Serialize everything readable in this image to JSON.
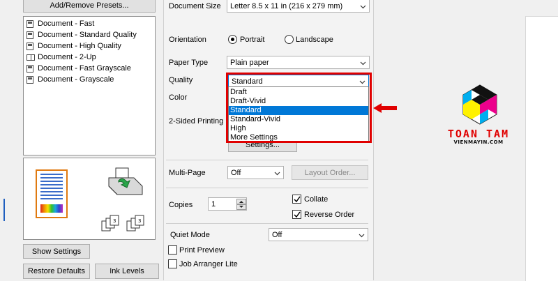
{
  "left_panel": {
    "add_remove_presets": "Add/Remove Presets...",
    "presets": [
      "Document - Fast",
      "Document - Standard Quality",
      "Document - High Quality",
      "Document - 2-Up",
      "Document - Fast Grayscale",
      "Document - Grayscale"
    ],
    "show_settings": "Show Settings",
    "restore_defaults": "Restore Defaults",
    "ink_levels": "Ink Levels"
  },
  "main": {
    "document_size": {
      "label": "Document Size",
      "value": "Letter 8.5 x 11 in (216 x 279 mm)"
    },
    "orientation": {
      "label": "Orientation",
      "portrait": "Portrait",
      "landscape": "Landscape",
      "selected": "Portrait"
    },
    "paper_type": {
      "label": "Paper Type",
      "value": "Plain paper"
    },
    "quality": {
      "label": "Quality",
      "value": "Standard",
      "options": [
        "Draft",
        "Draft-Vivid",
        "Standard",
        "Standard-Vivid",
        "High",
        "More Settings"
      ],
      "selected_index": 2
    },
    "color": {
      "label": "Color"
    },
    "two_sided": {
      "label": "2-Sided Printing",
      "settings_button": "Settings..."
    },
    "multi_page": {
      "label": "Multi-Page",
      "value": "Off",
      "layout_order": "Layout Order..."
    },
    "copies": {
      "label": "Copies",
      "value": "1",
      "collate": "Collate",
      "reverse_order": "Reverse Order"
    },
    "quiet_mode": {
      "label": "Quiet Mode",
      "value": "Off"
    },
    "print_preview": "Print Preview",
    "job_arranger": "Job Arranger Lite"
  },
  "logo": {
    "name": "TOAN TAM",
    "site": "VIENMAYIN.COM"
  },
  "colors": {
    "highlight": "#0078d7",
    "annotation_red": "#e00000"
  }
}
